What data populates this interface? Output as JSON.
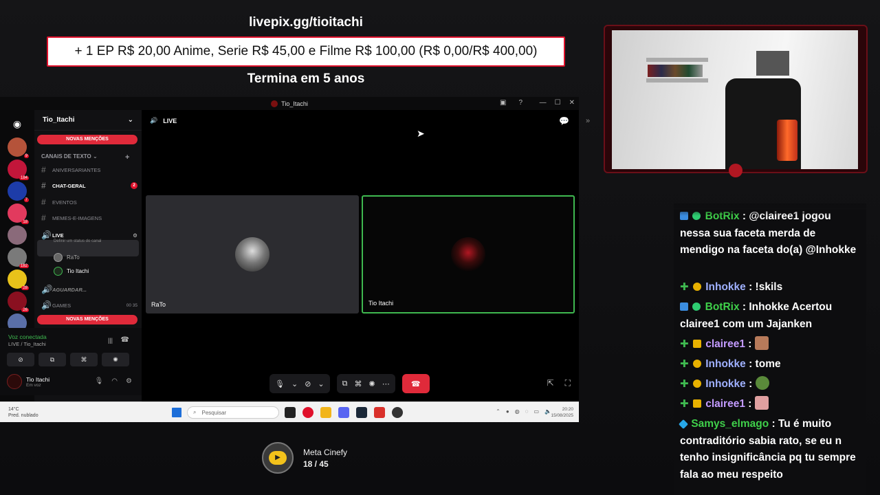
{
  "overlay": {
    "livepix_url": "livepix.gg/tioitachi",
    "goal_text": "+ 1 EP R$ 20,00 Anime, Serie R$ 45,00 e Filme R$ 100,00 (R$ 0,00/R$ 400,00)",
    "ends_text": "Termina em 5 anos"
  },
  "discord": {
    "window_title": "Tio_Itachi",
    "server_name": "Tio_Itachi",
    "mentions_label": "NOVAS MENÇÕES",
    "category_label": "CANAIS DE TEXTO",
    "channels": [
      {
        "name": "ANIVERSARIANTES"
      },
      {
        "name": "CHAT-GERAL",
        "badge": "2"
      },
      {
        "name": "EVENTOS"
      },
      {
        "name": "MEMES-E-IMAGENS"
      }
    ],
    "live_channel": {
      "name": "LIVE",
      "status_hint": "Definir um status do canal"
    },
    "voice_users": [
      "RaTo",
      "Tio Itachi"
    ],
    "other_channels": [
      {
        "name": "AGUARDAR..."
      },
      {
        "name": "GAMES",
        "counts": "00  35"
      }
    ],
    "server_badges": [
      "9",
      "184",
      "7",
      "18",
      "182",
      "28",
      "26"
    ],
    "voice_status": "Voz conectada",
    "voice_channel_path": "LIVE / Tio_Itachi",
    "me_name": "Tio Itachi",
    "me_status": "Em voz",
    "stage_title": "LIVE",
    "tiles": [
      {
        "name": "RaTo"
      },
      {
        "name": "Tio Itachi"
      }
    ]
  },
  "taskbar": {
    "weather": "14°C",
    "weather_desc": "Pred. nublado",
    "search_placeholder": "Pesquisar",
    "time": "20:20",
    "date": "15/08/2025"
  },
  "meta": {
    "title": "Meta Cinefy",
    "count": "18 / 45"
  },
  "chat": [
    {
      "user": "BotRix",
      "user_color": "#3fd04a",
      "text": ": @clairee1 jogou nessa sua faceta merda de mendigo na faceta do(a) @Inhokke"
    },
    {
      "user": "Inhokke",
      "user_color": "#9fb0ff",
      "text": ": !skils"
    },
    {
      "user": "BotRix",
      "user_color": "#3fd04a",
      "text": ": Inhokke Acertou clairee1 com um Jajanken"
    },
    {
      "user": "clairee1",
      "user_color": "#c39bff",
      "text": ":"
    },
    {
      "user": "Inhokke",
      "user_color": "#9fb0ff",
      "text": ": tome"
    },
    {
      "user": "Inhokke",
      "user_color": "#9fb0ff",
      "text": ":"
    },
    {
      "user": "clairee1",
      "user_color": "#c39bff",
      "text": ":"
    },
    {
      "user": "Samys_elmago",
      "user_color": "#3fd04a",
      "text": ": Tu é muito contraditório sabia rato, se eu n tenho insignificância pq tu sempre fala ao meu respeito"
    }
  ]
}
